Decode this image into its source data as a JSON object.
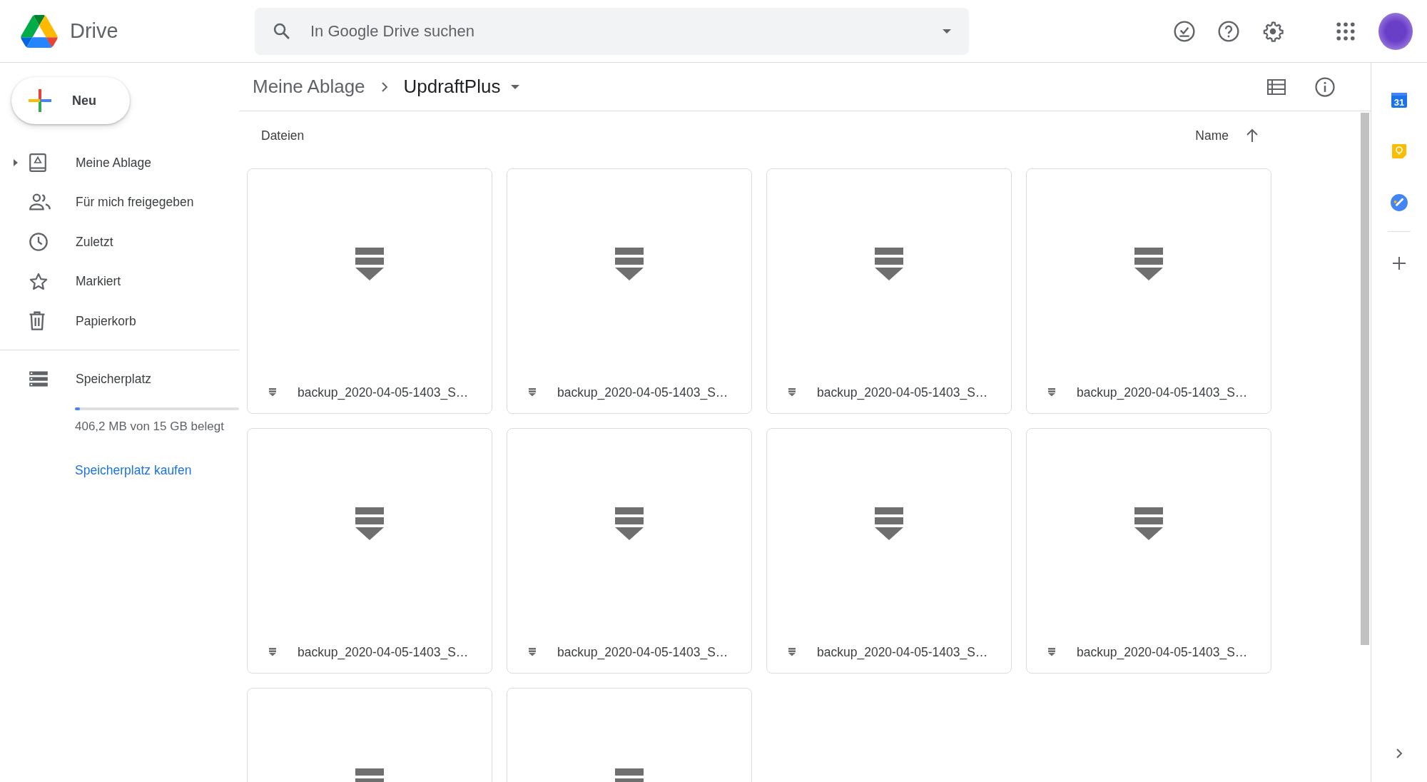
{
  "header": {
    "app_name": "Drive",
    "search": {
      "placeholder": "In Google Drive suchen"
    }
  },
  "sidebar": {
    "new_button": "Neu",
    "items": [
      {
        "label": "Meine Ablage",
        "kind": "tree"
      },
      {
        "label": "Für mich freigegeben",
        "kind": "link"
      },
      {
        "label": "Zuletzt",
        "kind": "link"
      },
      {
        "label": "Markiert",
        "kind": "link"
      },
      {
        "label": "Papierkorb",
        "kind": "link"
      }
    ],
    "storage": {
      "label": "Speicherplatz",
      "level": 0.03,
      "usage": "406,2 MB von 15 GB belegt",
      "buy_link": "Speicherplatz kaufen"
    }
  },
  "breadcrumb": [
    "Meine Ablage",
    "UpdraftPlus"
  ],
  "section_title": "Dateien",
  "sort": {
    "label": "Name"
  },
  "files": [
    {
      "kind": "file",
      "name": "backup_2020-04-05-1403_S…"
    },
    {
      "kind": "file",
      "name": "backup_2020-04-05-1403_S…"
    },
    {
      "kind": "file",
      "name": "backup_2020-04-05-1403_S…"
    },
    {
      "kind": "file",
      "name": "backup_2020-04-05-1403_S…"
    },
    {
      "kind": "file",
      "name": "backup_2020-04-05-1403_S…"
    },
    {
      "kind": "file",
      "name": "backup_2020-04-05-1403_S…"
    },
    {
      "kind": "file",
      "name": "backup_2020-04-05-1403_S…"
    },
    {
      "kind": "file",
      "name": "backup_2020-04-05-1403_S…"
    },
    {
      "kind": "partial"
    },
    {
      "kind": "partial"
    }
  ],
  "side_panel": {
    "calendar_day": "31"
  }
}
